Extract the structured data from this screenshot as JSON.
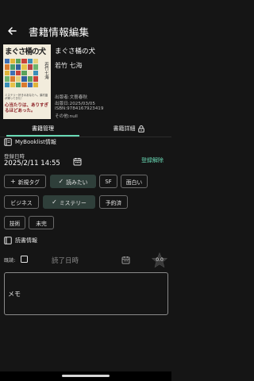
{
  "app_bar": {
    "title": "書籍情報編集"
  },
  "book": {
    "cover_title": "まぐさ桶の犬",
    "cover_author": "若竹七海",
    "cover_fineprint": "ミステリー好きのあなたへ。葉村晶が帰ってきた！",
    "cover_tagline": "心当たりは、ありすぎるほどあった。",
    "title": "まぐさ桶の犬",
    "author": "若竹 七海",
    "publisher": "出版者:文藝春秋",
    "published": "出版日:2025/03/05",
    "isbn": "ISBN:9784167923419",
    "other": "その他:null"
  },
  "tabs": [
    {
      "label": "書籍管理",
      "active": true
    },
    {
      "label": "書籍詳細",
      "active": false
    }
  ],
  "booklist": {
    "heading": "MyBooklist情報",
    "reg_label": "登録日時",
    "reg_date": "2025/2/11 14:55",
    "unregister_label": "登録解除"
  },
  "tags": {
    "add_label": "新規タグ",
    "items": [
      {
        "label": "読みたい",
        "selected": true
      },
      {
        "label": "SF",
        "selected": false
      },
      {
        "label": "面白い",
        "selected": false
      },
      {
        "label": "ビジネス",
        "selected": false
      },
      {
        "label": "ミステリー",
        "selected": true
      },
      {
        "label": "予約済",
        "selected": false
      },
      {
        "label": "技術",
        "selected": false
      },
      {
        "label": "未完",
        "selected": false
      }
    ]
  },
  "reading": {
    "heading": "読書情報",
    "read_label": "既読:",
    "read_end_placeholder": "読了日時",
    "rating": "0.0",
    "memo_placeholder": "メモ"
  },
  "colors": {
    "accent": "#69d9b5",
    "chip_selected_bg": "#2f3f3a",
    "background": "#151515"
  }
}
